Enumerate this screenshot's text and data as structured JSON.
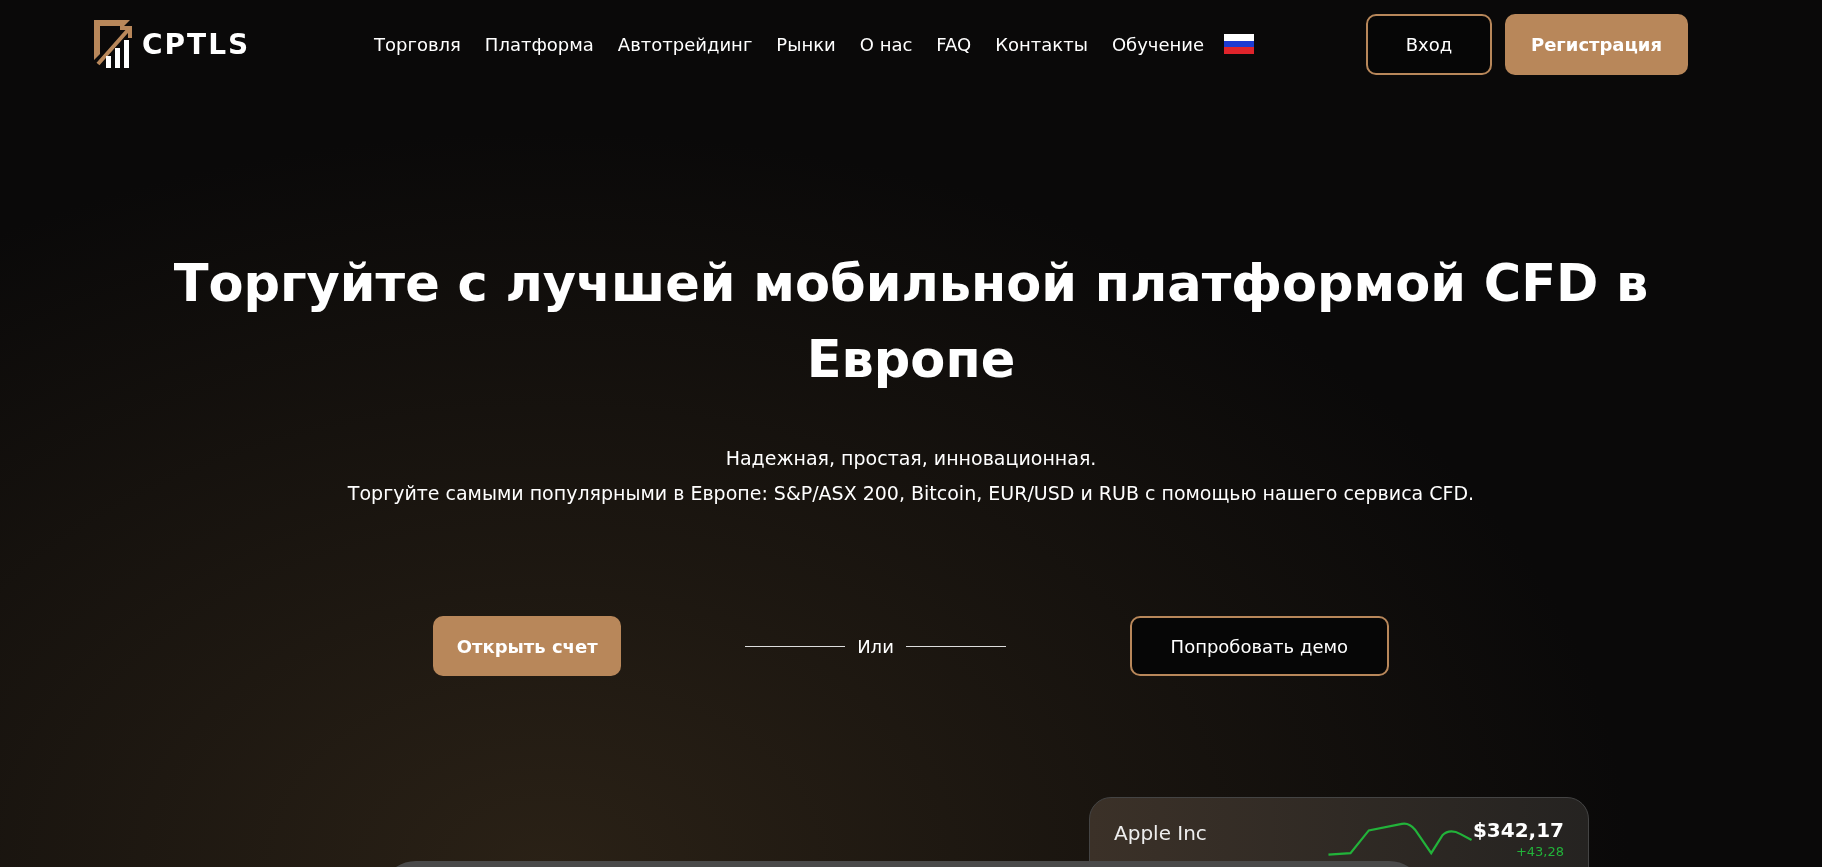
{
  "header": {
    "logo": "CPTLS",
    "nav": [
      {
        "label": "Торговля"
      },
      {
        "label": "Платформа"
      },
      {
        "label": "Автотрейдинг"
      },
      {
        "label": "Рынки"
      },
      {
        "label": "О нас"
      },
      {
        "label": "FAQ"
      },
      {
        "label": "Контакты"
      },
      {
        "label": "Обучение"
      }
    ],
    "login": "Вход",
    "register": "Регистрация"
  },
  "hero": {
    "title": "Торгуйте с лучшей мобильной платформой CFD в Европе",
    "subtitle": [
      "Надежная, простая, инновационная.",
      "Торгуйте самыми популярными в Европе: S&P/ASX 200, Bitcoin, EUR/USD и RUB с помощью нашего сервиса CFD."
    ],
    "open_account": "Открыть счет",
    "or": "Или",
    "demo": "Попробовать демо"
  },
  "stock_card": {
    "name": "Apple Inc",
    "price": "$342,17",
    "change": "+43,28"
  }
}
